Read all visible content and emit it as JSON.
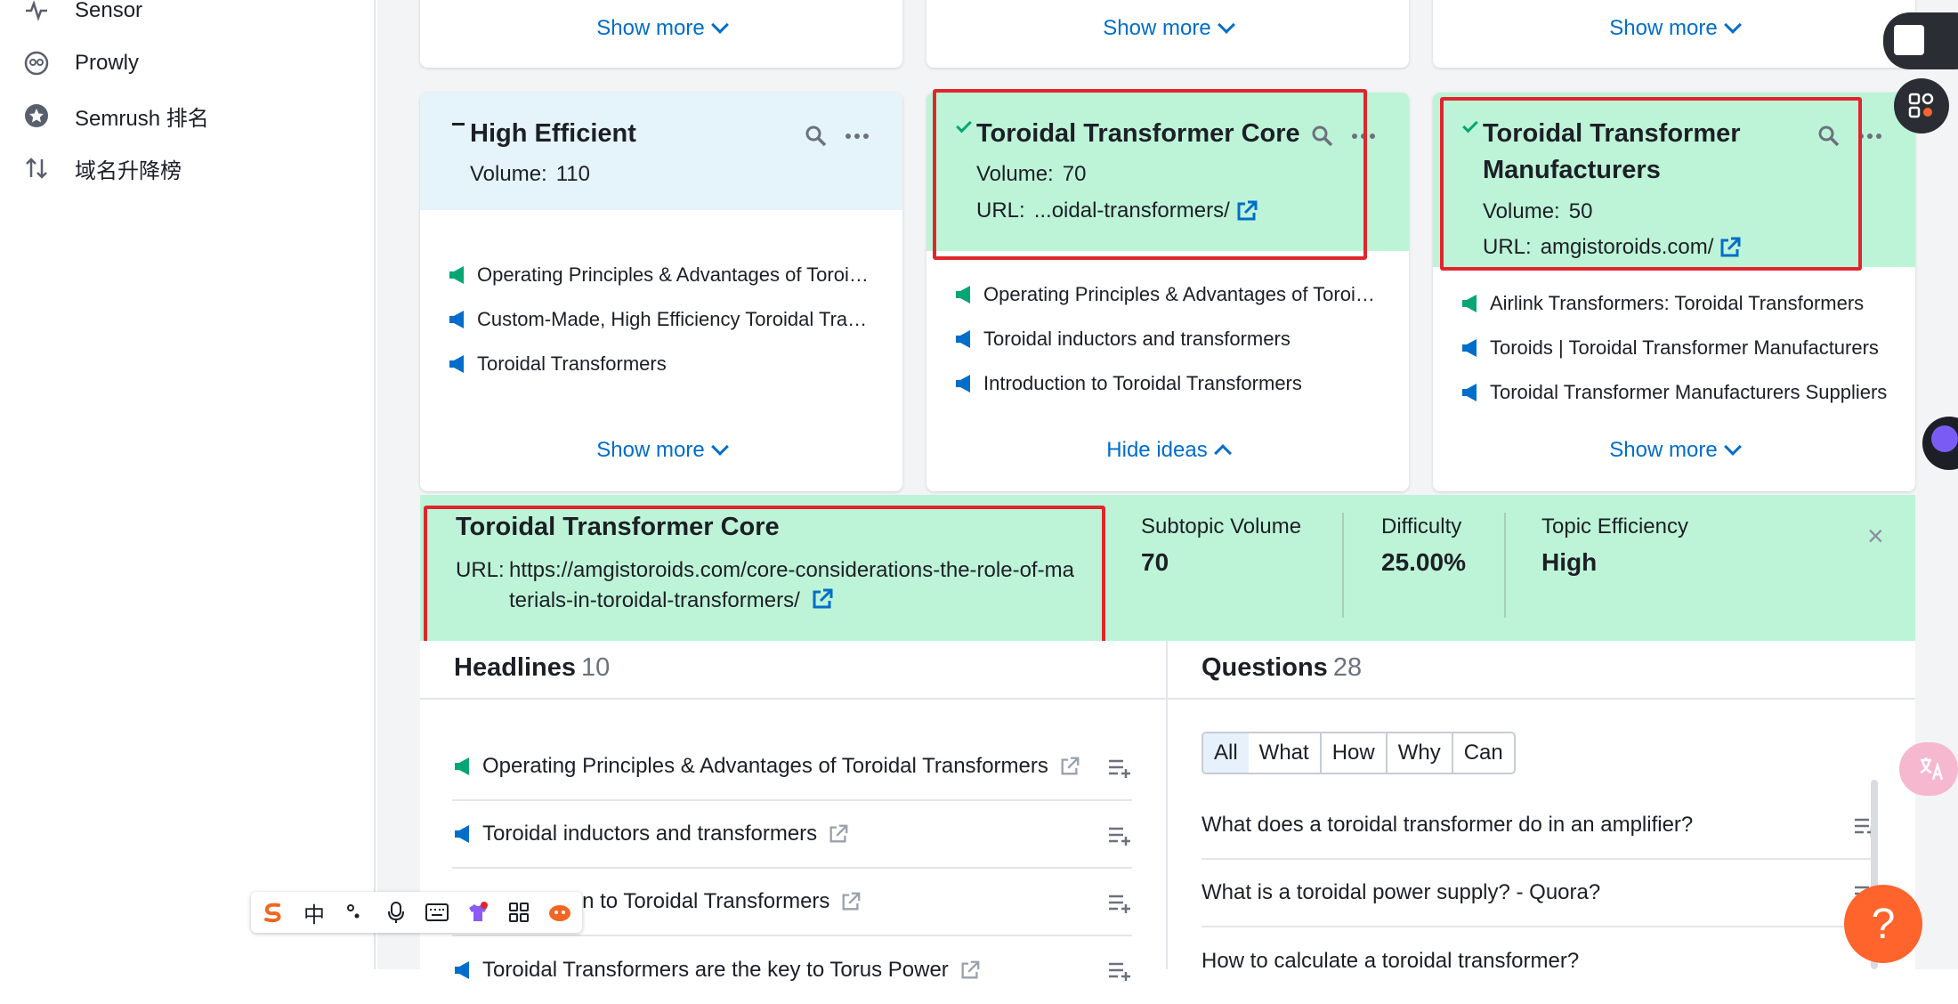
{
  "sidebar": {
    "items": [
      {
        "label": "Sensor",
        "icon": "pulse-icon"
      },
      {
        "label": "Prowly",
        "icon": "owl-icon"
      },
      {
        "label": "Semrush 排名",
        "icon": "star-icon"
      },
      {
        "label": "域名升降榜",
        "icon": "sort-arrows-icon"
      }
    ]
  },
  "top_cards": {
    "show_more": "Show more"
  },
  "cards": [
    {
      "title": "High Efficient",
      "volume_label": "Volume:",
      "volume": "110",
      "ideas": [
        "Operating Principles & Advantages of Toroidal Transformers",
        "Custom-Made, High Efficiency Toroidal Transformers",
        "Toroidal Transformers"
      ],
      "toggle": "Show more"
    },
    {
      "title": "Toroidal Transformer Core",
      "volume_label": "Volume:",
      "volume": "70",
      "url_label": "URL:",
      "url": "...oidal-transformers/",
      "ideas": [
        "Operating Principles & Advantages of Toroidal Transformers",
        "Toroidal inductors and transformers",
        "Introduction to Toroidal Transformers"
      ],
      "toggle": "Hide ideas"
    },
    {
      "title_line1": "Toroidal Transformer",
      "title_line2": "Manufacturers",
      "volume_label": "Volume:",
      "volume": "50",
      "url_label": "URL:",
      "url": "amgistoroids.com/",
      "ideas": [
        "Airlink Transformers: Toroidal Transformers",
        "Toroids | Toroidal Transformer Manufacturers",
        "Toroidal Transformer Manufacturers Suppliers"
      ],
      "toggle": "Show more"
    }
  ],
  "detail": {
    "title": "Toroidal Transformer Core",
    "url_label": "URL:",
    "url": "https://amgistoroids.com/core-considerations-the-role-of-materials-in-toroidal-transformers/",
    "metrics": [
      {
        "label": "Subtopic Volume",
        "value": "70"
      },
      {
        "label": "Difficulty",
        "value": "25.00%"
      },
      {
        "label": "Topic Efficiency",
        "value": "High"
      }
    ],
    "close": "×"
  },
  "headlines": {
    "title": "Headlines",
    "count": "10",
    "items": [
      "Operating Principles & Advantages of Toroidal Transformers",
      "Toroidal inductors and transformers",
      "Introduction to Toroidal Transformers",
      "Toroidal Transformers are the key to Torus Power"
    ]
  },
  "questions": {
    "title": "Questions",
    "count": "28",
    "filters": [
      "All",
      "What",
      "How",
      "Why",
      "Can"
    ],
    "items": [
      "What does a toroidal transformer do in an amplifier?",
      "What is a toroidal power supply? - Quora?",
      "How to calculate a toroidal transformer?"
    ]
  },
  "help": "?",
  "ime": {
    "zh": "中"
  },
  "colors": {
    "accent": "#006dca",
    "highlight": "#bdf4d8",
    "red": "#e0262c",
    "help": "#ff642d"
  }
}
